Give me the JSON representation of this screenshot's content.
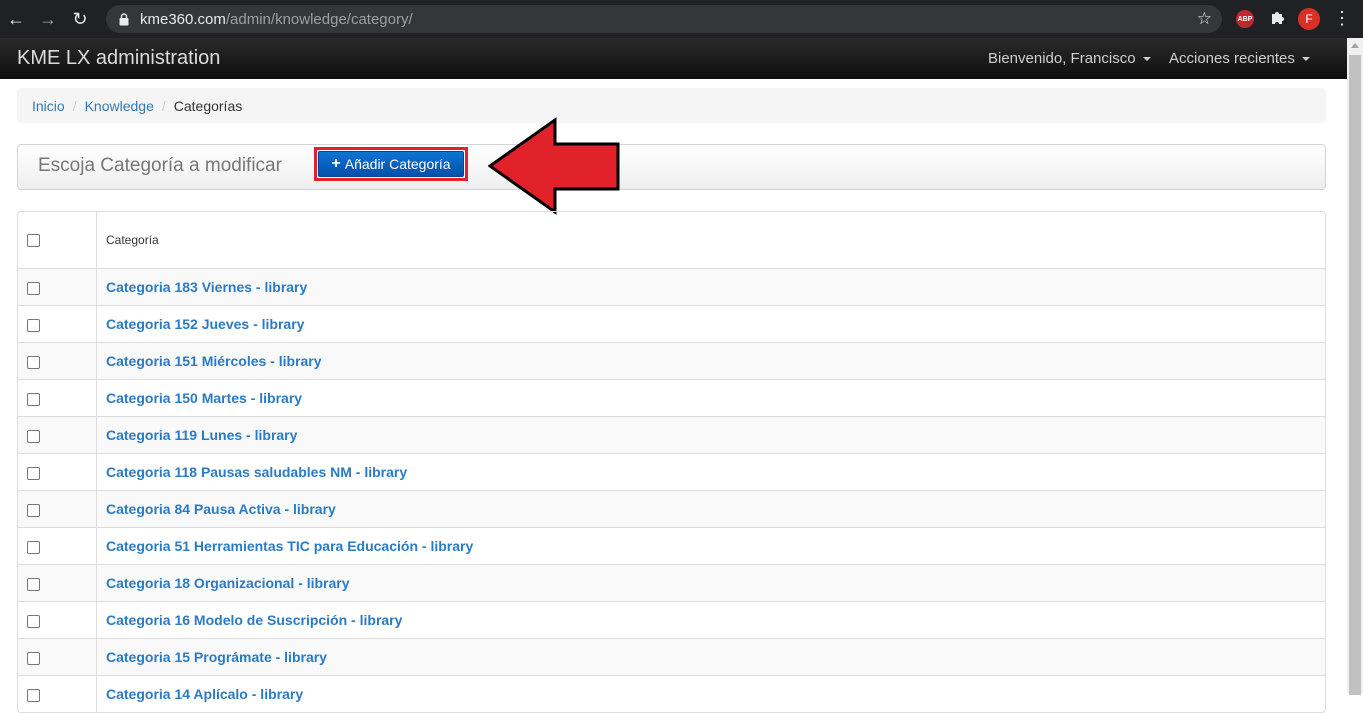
{
  "browser": {
    "url_host": "kme360.com",
    "url_path": "/admin/knowledge/category/",
    "ext_abp": "ABP",
    "profile_initial": "F"
  },
  "navbar": {
    "brand": "KME LX administration",
    "user_menu": "Bienvenido, Francisco",
    "recent_actions": "Acciones recientes"
  },
  "breadcrumb": {
    "home": "Inicio",
    "app": "Knowledge",
    "current": "Categorías",
    "separator": "/"
  },
  "toolbar": {
    "title": "Escoja Categoría a modificar",
    "add_label": "Añadir Categoría"
  },
  "table": {
    "header": "Categoría",
    "rows": [
      "Categoria 183 Viernes - library",
      "Categoria 152 Jueves - library",
      "Categoria 151 Miércoles - library",
      "Categoria 150 Martes - library",
      "Categoria 119 Lunes - library",
      "Categoria 118 Pausas saludables NM - library",
      "Categoria 84 Pausa Activa - library",
      "Categoria 51 Herramientas TIC para Educación - library",
      "Categoria 18 Organizacional - library",
      "Categoria 16 Modelo de Suscripción - library",
      "Categoria 15 Prográmate - library",
      "Categoria 14 Aplícalo - library"
    ]
  },
  "colors": {
    "link": "#2a7bc4",
    "primary_button": "#0c74d6",
    "highlight_arrow": "#e1222a",
    "navbar": "#1b1b1b"
  }
}
